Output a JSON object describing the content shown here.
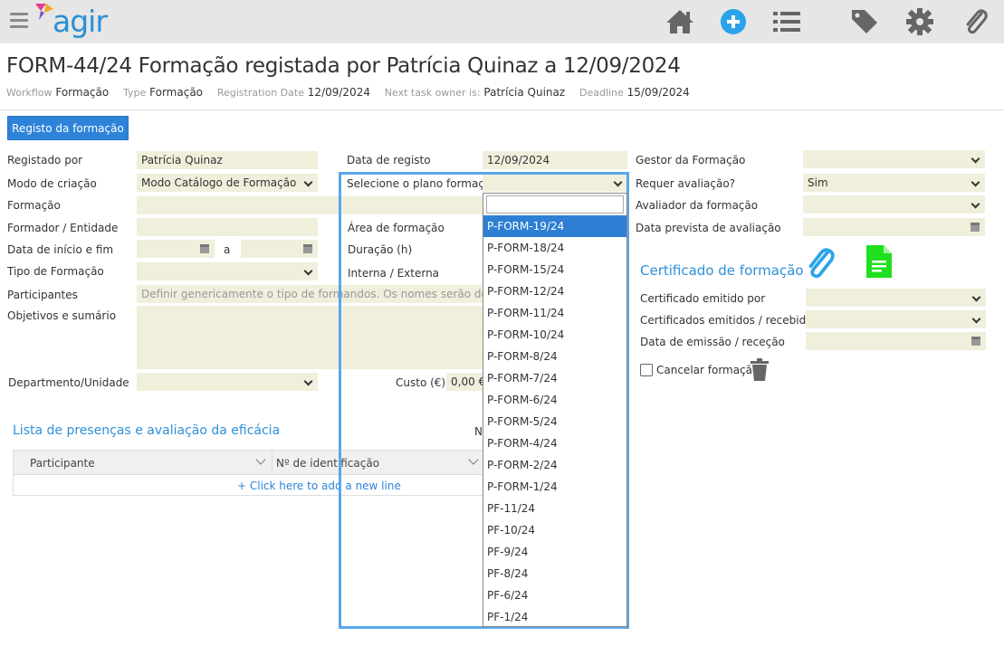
{
  "app": {
    "logo_text": "agir"
  },
  "topbar": {
    "icons": [
      "home-icon",
      "add-icon",
      "list-icon",
      "tags-icon",
      "settings-icon",
      "attachment-icon"
    ]
  },
  "title": "FORM-44/24 Formação registada por Patrícia Quinaz a 12/09/2024",
  "meta": {
    "workflow_label": "Workflow",
    "workflow_value": "Formação",
    "type_label": "Type",
    "type_value": "Formação",
    "regdate_label": "Registration Date",
    "regdate_value": "12/09/2024",
    "owner_label": "Next task owner is:",
    "owner_value": "Patrícia Quinaz",
    "deadline_label": "Deadline",
    "deadline_value": "15/09/2024"
  },
  "tab": {
    "label": "Registo da formação"
  },
  "form": {
    "registado_por_label": "Registado por",
    "registado_por_value": "Patrícia Quinaz",
    "modo_label": "Modo de criação",
    "modo_value": "Modo Catálogo de Formação",
    "formacao_label": "Formação",
    "formador_label": "Formador / Entidade",
    "datas_label": "Data de início e fim",
    "datas_sep": "a",
    "tipo_label": "Tipo de Formação",
    "participantes_label": "Participantes",
    "participantes_placeholder": "Definir genericamente o tipo de formandos. Os nomes serão definidos n",
    "objetivos_label": "Objetivos e sumário",
    "departamento_label": "Departmento/Unidade",
    "data_registo_label": "Data de registo",
    "data_registo_value": "12/09/2024",
    "plano_label": "Selecione o plano formação",
    "area_label": "Área de formação",
    "duracao_label": "Duração (h)",
    "interna_label": "Interna / Externa",
    "custo_label": "Custo (€)",
    "custo_value": "0,00 €",
    "gestor_label": "Gestor da Formação",
    "requer_label": "Requer avaliação?",
    "requer_value": "Sim",
    "avaliador_label": "Avaliador da formação",
    "data_prevista_label": "Data prevista de avaliação"
  },
  "certificado": {
    "title": "Certificado de formação",
    "emitido_por_label": "Certificado emitido por",
    "emitidos_label": "Certificados emitidos / recebidos?",
    "data_emissao_label": "Data de emissão / receção",
    "cancelar_label": "Cancelar formação"
  },
  "presencas": {
    "title": "Lista de presenças e avaliação da eficácia",
    "n_label": "N",
    "columns": [
      "Participante",
      "Nº de identificação"
    ],
    "add_line": "+ Click here to add a new line"
  },
  "dropdown": {
    "items": [
      "P-FORM-19/24",
      "P-FORM-18/24",
      "P-FORM-15/24",
      "P-FORM-12/24",
      "P-FORM-11/24",
      "P-FORM-10/24",
      "P-FORM-8/24",
      "P-FORM-7/24",
      "P-FORM-6/24",
      "P-FORM-5/24",
      "P-FORM-4/24",
      "P-FORM-2/24",
      "P-FORM-1/24",
      "PF-11/24",
      "PF-10/24",
      "PF-9/24",
      "PF-8/24",
      "PF-6/24",
      "PF-1/24"
    ],
    "highlighted": "P-FORM-19/24"
  },
  "colors": {
    "accent": "#2e83d9",
    "field_bg": "#efefdc",
    "topbar_bg": "#e6e6e6",
    "add_icon": "#2ba3e8",
    "doc_icon": "#1fe01f"
  }
}
